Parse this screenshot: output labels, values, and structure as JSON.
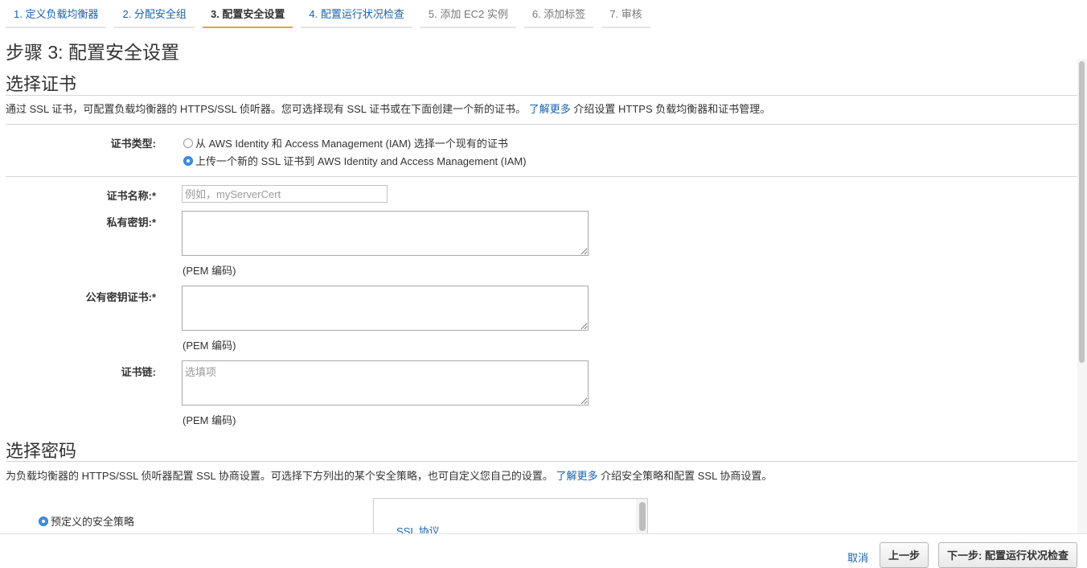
{
  "wizard": {
    "steps": [
      {
        "label": "1. 定义负载均衡器"
      },
      {
        "label": "2. 分配安全组"
      },
      {
        "label": "3. 配置安全设置"
      },
      {
        "label": "4. 配置运行状况检查"
      },
      {
        "label": "5. 添加 EC2 实例"
      },
      {
        "label": "6. 添加标签"
      },
      {
        "label": "7. 审核"
      }
    ]
  },
  "page_title": "步骤 3: 配置安全设置",
  "cert_section": {
    "heading": "选择证书",
    "desc_before": "通过 SSL 证书，可配置负载均衡器的 HTTPS/SSL 侦听器。您可选择现有 SSL 证书或在下面创建一个新的证书。",
    "desc_link": "了解更多",
    "desc_after": " 介绍设置 HTTPS 负载均衡器和证书管理。",
    "type_label": "证书类型:",
    "option_existing": "从 AWS Identity 和 Access Management (IAM) 选择一个现有的证书",
    "option_upload": "上传一个新的 SSL 证书到 AWS Identity and Access Management (IAM)",
    "name_label": "证书名称:*",
    "name_placeholder": "例如，myServerCert",
    "private_key_label": "私有密钥:*",
    "private_key_hint": "(PEM 编码)",
    "public_cert_label": "公有密钥证书:*",
    "public_cert_hint": "(PEM 编码)",
    "chain_label": "证书链:",
    "chain_placeholder": "选填项",
    "chain_hint": "(PEM 编码)"
  },
  "cipher_section": {
    "heading": "选择密码",
    "desc_before": "为负载均衡器的 HTTPS/SSL 侦听器配置 SSL 协商设置。可选择下方列出的某个安全策略，也可自定义您自己的设置。",
    "desc_link": "了解更多",
    "desc_after": " 介绍安全策略和配置 SSL 协商设置。",
    "predefined_policy": "预定义的安全策略",
    "ssl_protocol": "SSL 协议"
  },
  "footer": {
    "cancel": "取消",
    "previous": "上一步",
    "next": "下一步: 配置运行状况检查"
  }
}
